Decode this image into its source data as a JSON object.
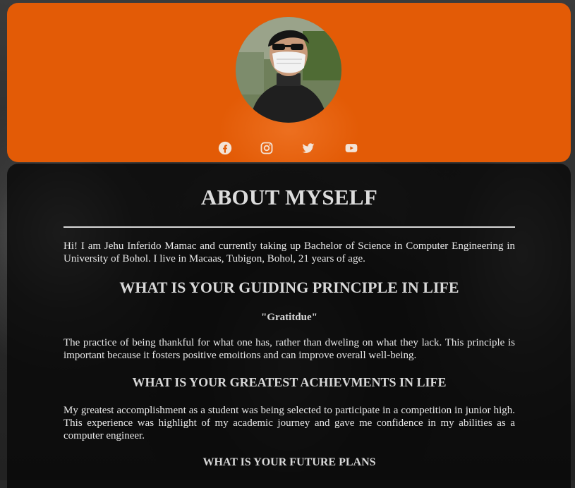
{
  "profile": {
    "avatar_alt": "Profile photo of a person wearing a face mask and sunglasses"
  },
  "socials": [
    {
      "icon": "facebook-icon"
    },
    {
      "icon": "instagram-icon"
    },
    {
      "icon": "twitter-icon"
    },
    {
      "icon": "youtube-icon"
    }
  ],
  "colors": {
    "header": "#e35b06",
    "card": "#0a0a0a",
    "text": "#e8e8e8"
  },
  "about": {
    "title": "ABOUT MYSELF",
    "intro": "Hi! I am Jehu Inferido Mamac and currently taking up Bachelor of Science in Computer Engineering in University of Bohol. I live in Macaas, Tubigon, Bohol, 21 years of age.",
    "principle_heading": "WHAT IS YOUR GUIDING PRINCIPLE IN LIFE",
    "principle_quote": "\"Gratitdue\"",
    "principle_text": "The practice of being thankful for what one has, rather than dweling on what they lack. This principle is important because it fosters positive emoitions and can improve overall well-being.",
    "achievement_heading": "WHAT IS YOUR GREATEST ACHIEVMENTS IN LIFE",
    "achievement_text": "My greatest accomplishment as a student was being selected to participate in a competition in junior high. This experience was highlight of my academic journey and gave me confidence in my abilities as a computer engineer.",
    "plans_heading": "WHAT IS YOUR FUTURE PLANS"
  }
}
